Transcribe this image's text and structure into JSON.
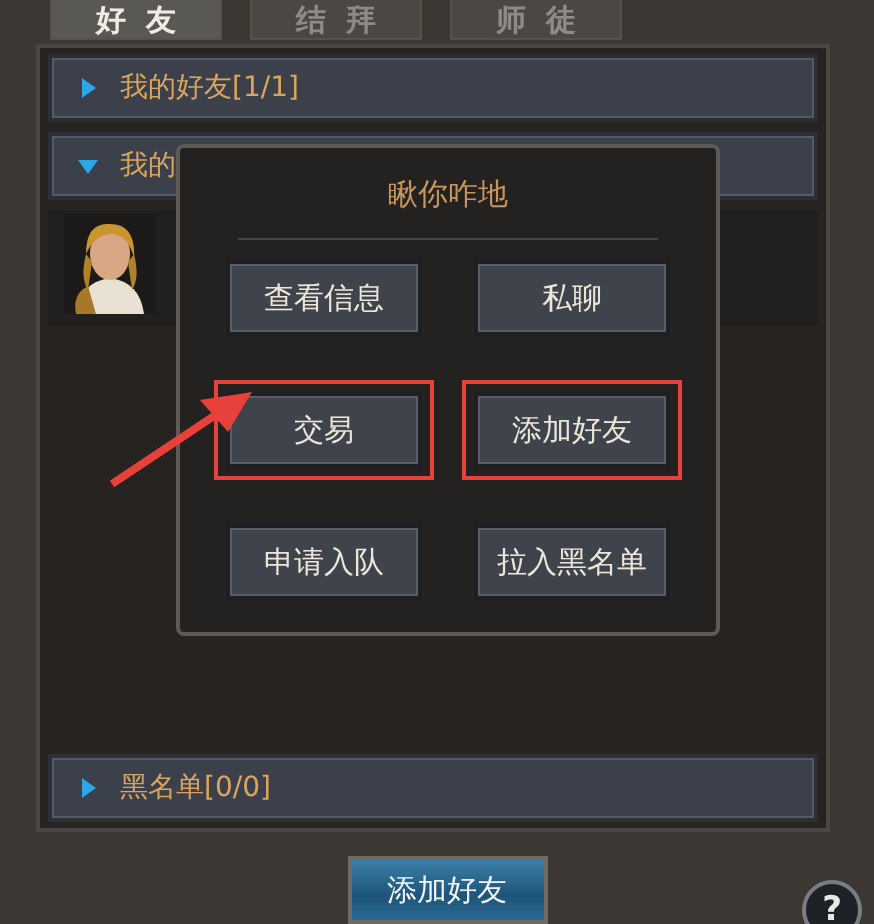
{
  "tabs": [
    {
      "label": "好友",
      "selected": true
    },
    {
      "label": "结拜",
      "selected": false
    },
    {
      "label": "师徒",
      "selected": false
    }
  ],
  "groups": [
    {
      "label": "我的好友[1/1]",
      "expanded": false
    },
    {
      "label": "我的",
      "expanded": true
    },
    {
      "label": "黑名单[0/0]",
      "expanded": false
    }
  ],
  "popup": {
    "title": "瞅你咋地",
    "buttons": [
      {
        "label": "查看信息",
        "highlighted": false,
        "arrow": false
      },
      {
        "label": "私聊",
        "highlighted": false,
        "arrow": false
      },
      {
        "label": "交易",
        "highlighted": true,
        "arrow": true
      },
      {
        "label": "添加好友",
        "highlighted": true,
        "arrow": false
      },
      {
        "label": "申请入队",
        "highlighted": false,
        "arrow": false
      },
      {
        "label": "拉入黑名单",
        "highlighted": false,
        "arrow": false
      }
    ]
  },
  "add_friend_button": "添加好友",
  "help_icon": "?"
}
